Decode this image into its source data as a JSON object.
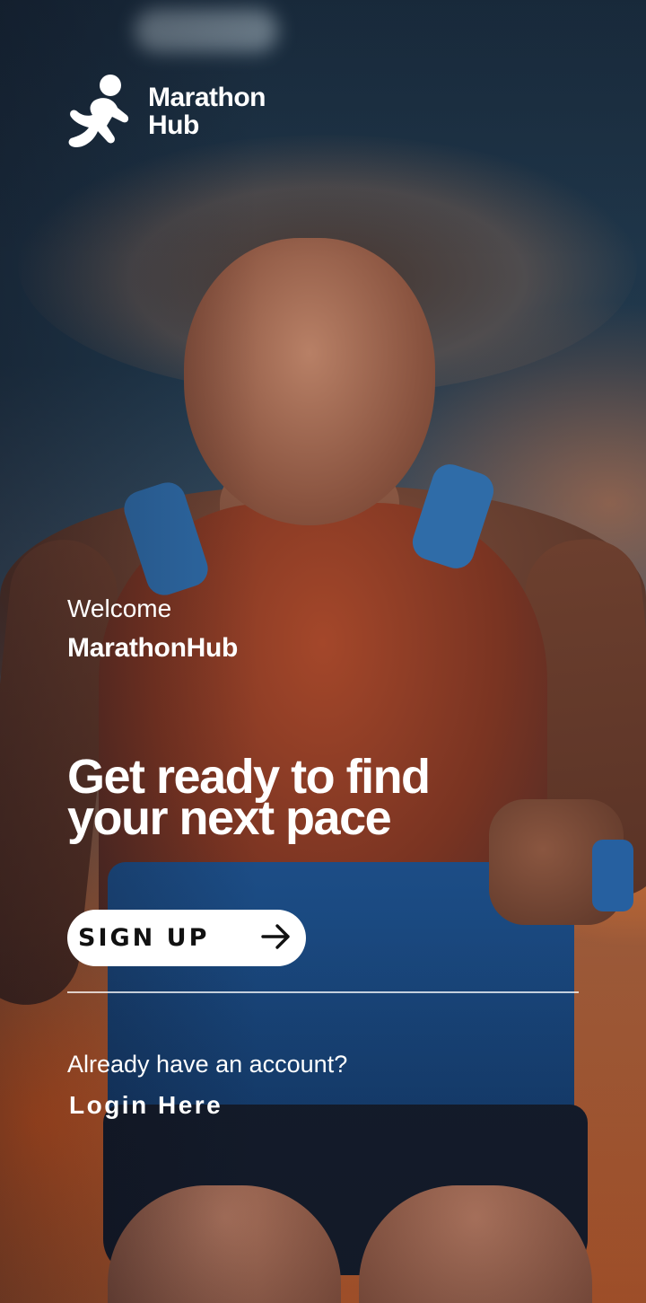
{
  "brand": {
    "logo_icon": "runner-icon",
    "name_line1": "Marathon",
    "name_line2": "Hub"
  },
  "welcome": {
    "greeting": "Welcome",
    "app_name": "MarathonHub"
  },
  "hero": {
    "headline_line1": "Get ready to find",
    "headline_line2": "your next pace"
  },
  "signup": {
    "label": "SIGN UP",
    "icon": "arrow-right-icon"
  },
  "login": {
    "prompt": "Already have an account?",
    "link_label": "Login Here"
  },
  "colors": {
    "text": "#ffffff",
    "button_bg": "#ffffff",
    "button_text": "#111111"
  }
}
